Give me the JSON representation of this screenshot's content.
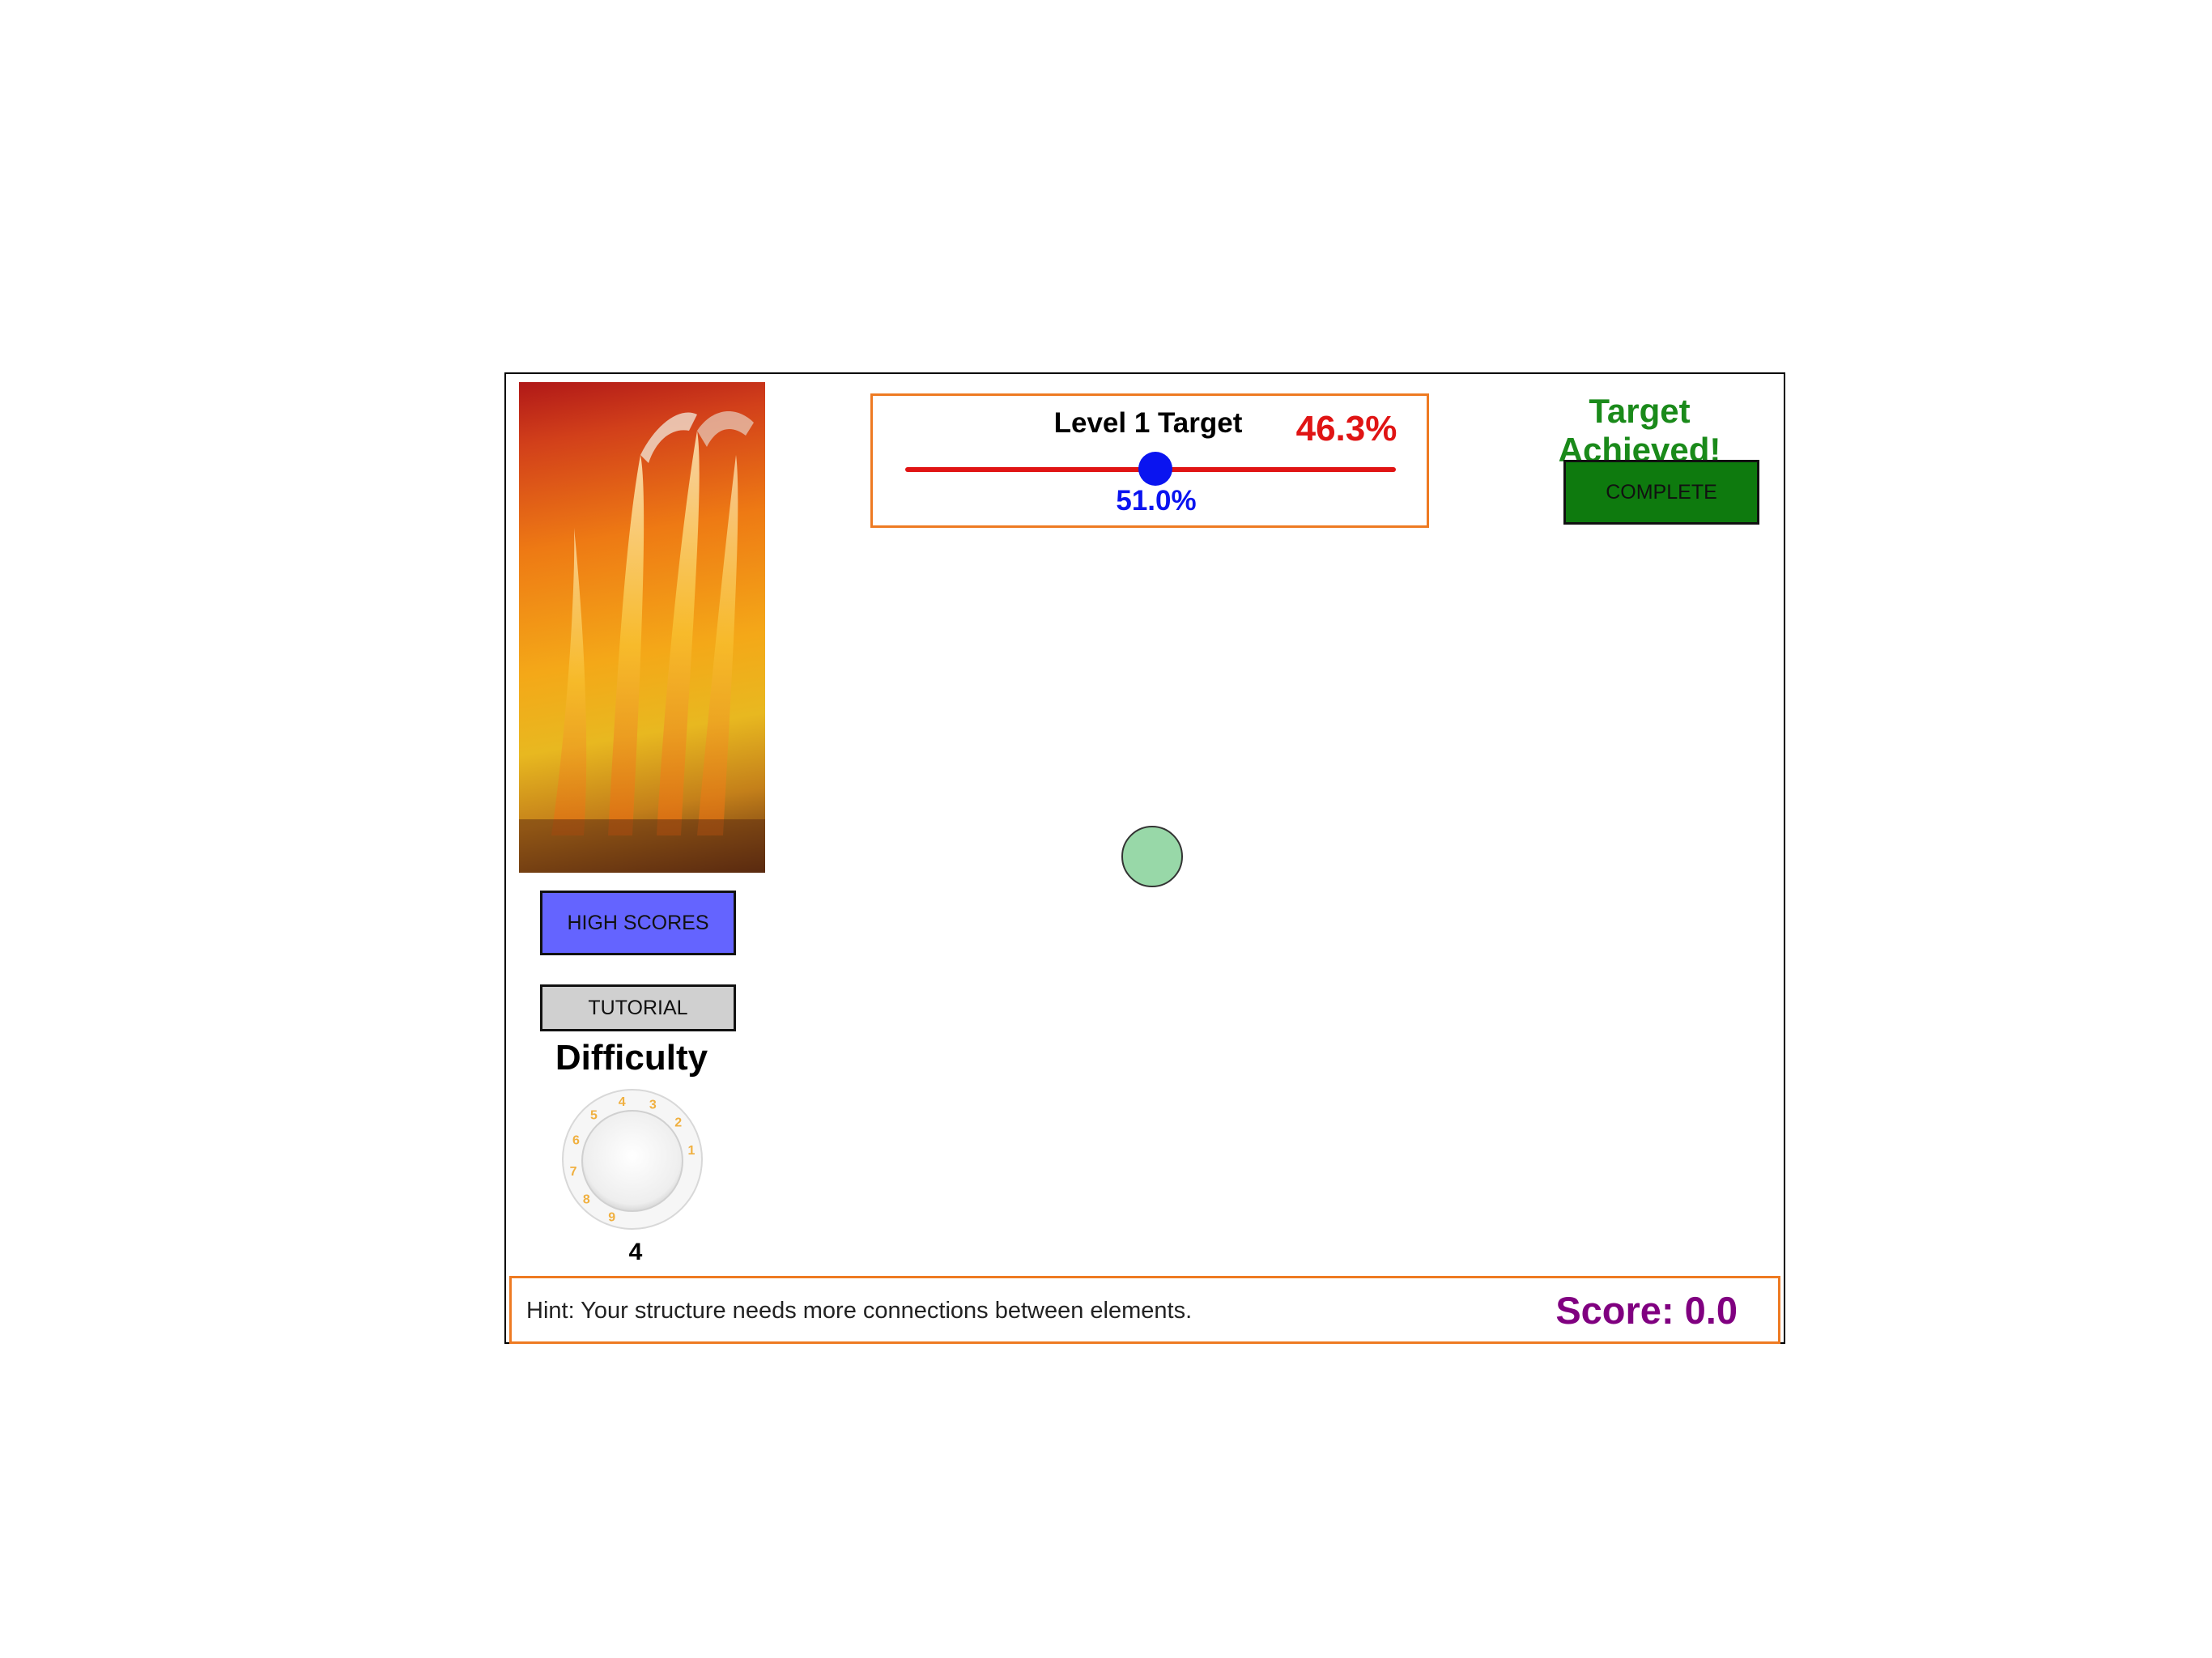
{
  "sidebar": {
    "high_scores_label": "HIGH SCORES",
    "tutorial_label": "TUTORIAL",
    "difficulty_label": "Difficulty",
    "difficulty_value": "4",
    "knob_numbers": [
      "1",
      "2",
      "3",
      "4",
      "5",
      "6",
      "7",
      "8",
      "9"
    ]
  },
  "target": {
    "title": "Level 1 Target",
    "current_value": "46.3%",
    "slider_value_label": "51.0%",
    "slider_fraction": 0.51
  },
  "status": {
    "achieved_text": "Target Achieved!",
    "complete_label": "COMPLETE"
  },
  "bottom": {
    "hint": "Hint: Your structure needs more connections between elements.",
    "score": "Score: 0.0"
  },
  "colors": {
    "slider_track": "#e01414",
    "slider_thumb": "#0a14f0",
    "node_fill": "#98d8a8",
    "complete_button": "#0e7a0e",
    "high_scores_button": "#6464ff",
    "score_text": "#800080",
    "accent_border": "#ee7a22"
  }
}
